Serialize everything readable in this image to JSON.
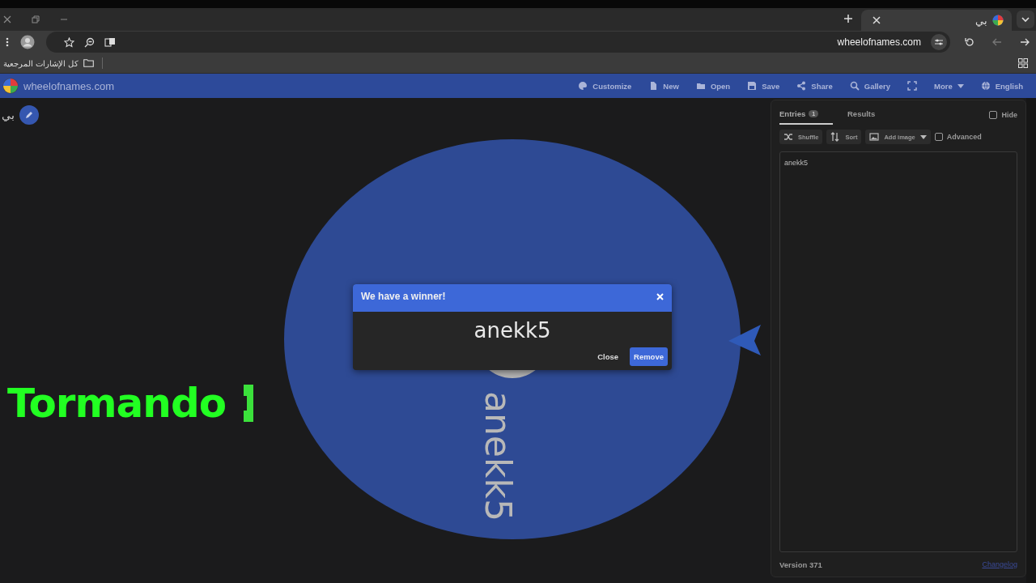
{
  "browser": {
    "tab": {
      "title": "بي"
    },
    "address": "wheelofnames.com",
    "bookmarks": [
      {
        "label": "كل الإشارات المرجعية"
      }
    ]
  },
  "app": {
    "logo": "wheelofnames.com",
    "menu": [
      {
        "kind": "button",
        "label": "Customize"
      },
      {
        "kind": "button",
        "label": "New"
      },
      {
        "kind": "button",
        "label": "Open"
      },
      {
        "kind": "button",
        "label": "Save"
      },
      {
        "kind": "button",
        "label": "Share"
      },
      {
        "kind": "button",
        "label": "Gallery"
      },
      {
        "kind": "icon"
      },
      {
        "kind": "dropdown",
        "label": "More"
      },
      {
        "kind": "button",
        "label": "English"
      }
    ]
  },
  "wheel_title": "بي",
  "wheel": {
    "segments": [
      {
        "label": "anekk5",
        "color": "#2e4a94"
      }
    ]
  },
  "dialog": {
    "title": "We have a winner!",
    "winner": "anekk5",
    "buttons": [
      {
        "kind": "text",
        "label": "Close"
      },
      {
        "kind": "primary",
        "label": "Remove"
      }
    ]
  },
  "overlay_caption": "Tormando",
  "panel": {
    "tabs": [
      {
        "label": "Entries",
        "count": "1",
        "selected": true
      },
      {
        "label": "Results",
        "selected": false
      }
    ],
    "hide": {
      "label": "Hide",
      "checked": false
    },
    "tools": [
      {
        "label": "Shuffle",
        "dropdown": false
      },
      {
        "label": "Sort",
        "dropdown": false
      },
      {
        "label": "Add image",
        "dropdown": true
      }
    ],
    "advanced": {
      "label": "Advanced",
      "checked": false
    },
    "entries": "anekk5",
    "version": "Version 371",
    "changelog": "Changelog"
  }
}
